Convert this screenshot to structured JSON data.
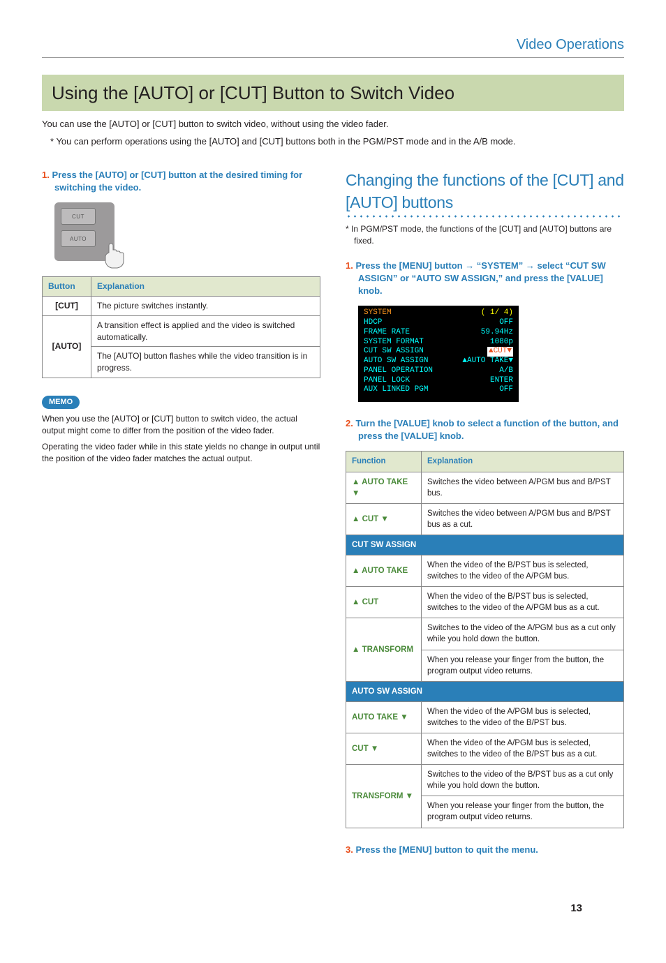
{
  "header": {
    "section": "Video Operations"
  },
  "title": "Using the [AUTO] or [CUT] Button to Switch Video",
  "intro": "You can use the [AUTO] or [CUT] button to switch video, without using the video fader.",
  "intro_star": "You can perform operations using the [AUTO] and [CUT] buttons both in the PGM/PST mode and in the A/B mode.",
  "left": {
    "step1_num": "1.",
    "step1_text": "Press the [AUTO] or [CUT] button at the desired timing for switching the video.",
    "btn_cut": "CUT",
    "btn_auto": "AUTO",
    "table": {
      "h1": "Button",
      "h2": "Explanation",
      "r1c1": "[CUT]",
      "r1c2": "The picture switches instantly.",
      "r2c1": "[AUTO]",
      "r2c2a": "A transition effect is applied and the video is switched automatically.",
      "r2c2b": "The [AUTO] button flashes while the video transition is in progress."
    },
    "memo_label": "MEMO",
    "memo1": "When you use the [AUTO] or [CUT] button to switch video, the actual output might come to differ from the position of the video fader.",
    "memo2": "Operating the video fader while in this state yields no change in output until the position of the video fader matches the actual output."
  },
  "right": {
    "heading": "Changing the functions of the [CUT] and [AUTO] buttons",
    "note": "In PGM/PST mode, the functions of the [CUT] and [AUTO] buttons are fixed.",
    "step1_num": "1.",
    "step1_text": "Press the [MENU] button → “SYSTEM” → select “CUT SW ASSIGN” or “AUTO SW ASSIGN,” and press the [VALUE] knob.",
    "menu": {
      "title_l": "SYSTEM",
      "title_r": "( 1/ 4)",
      "r1l": "HDCP",
      "r1r": "OFF",
      "r2l": "FRAME RATE",
      "r2r": "59.94Hz",
      "r3l": "SYSTEM FORMAT",
      "r3r": "1080p",
      "r4l": "CUT SW ASSIGN",
      "r4r": "▲CUT▼",
      "r5l": "AUTO SW ASSIGN",
      "r5r": "▲AUTO TAKE▼",
      "r6l": "PANEL OPERATION",
      "r6r": "A/B",
      "r7l": "PANEL LOCK",
      "r7r": "ENTER",
      "r8l": "AUX LINKED PGM",
      "r8r": "OFF"
    },
    "step2_num": "2.",
    "step2_text": "Turn the [VALUE] knob to select a function of the button, and press the [VALUE] knob.",
    "func_h1": "Function",
    "func_h2": "Explanation",
    "func_rows": {
      "r1n": "▲ AUTO TAKE ▼",
      "r1e": "Switches the video between A/PGM bus and B/PST bus.",
      "r2n": "▲ CUT ▼",
      "r2e": "Switches the video between A/PGM bus and B/PST bus as a cut.",
      "sec1": "CUT SW ASSIGN",
      "r3n": "▲ AUTO TAKE",
      "r3e": "When the video of the B/PST bus is selected, switches to the video of the A/PGM bus.",
      "r4n": "▲ CUT",
      "r4e": "When the video of the B/PST bus is selected, switches to the video of the A/PGM bus as a cut.",
      "r5n": "▲ TRANSFORM",
      "r5e1": "Switches to the video of the A/PGM bus as a cut only while you hold down the button.",
      "r5e2": "When you release your finger from the button, the program output video returns.",
      "sec2": "AUTO SW ASSIGN",
      "r6n": "AUTO TAKE ▼",
      "r6e": "When the video of the A/PGM bus is selected, switches to the video of the B/PST bus.",
      "r7n": "CUT ▼",
      "r7e": "When the video of the A/PGM bus is selected, switches to the video of the B/PST bus as a cut.",
      "r8n": "TRANSFORM ▼",
      "r8e1": "Switches to the video of the B/PST bus as a cut only while you hold down the button.",
      "r8e2": "When you release your finger from the button, the program output video returns."
    },
    "step3_num": "3.",
    "step3_text": "Press the [MENU] button to quit the menu."
  },
  "page_number": "13"
}
